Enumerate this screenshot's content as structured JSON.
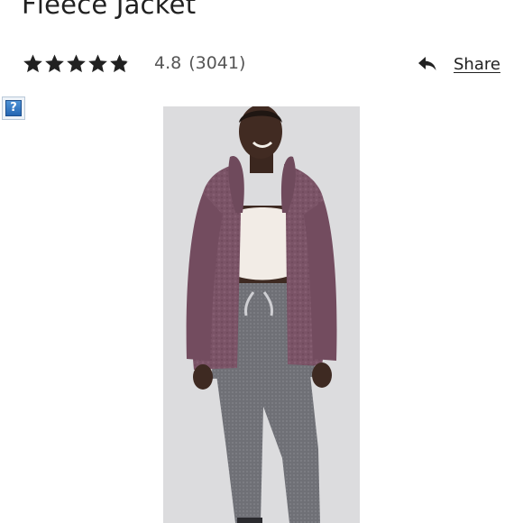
{
  "product": {
    "title": "Fleece Jacket",
    "rating": {
      "value": "4.8",
      "count": "(3041)",
      "stars": 4.8,
      "max_stars": 5
    },
    "share_label": "Share",
    "image_icon": "help-question-icon",
    "image_icon_glyph": "?",
    "image_alt": "Woman wearing mauve fleece jacket over white crop top and grey joggers"
  },
  "colors": {
    "text": "#212121",
    "muted": "#555555",
    "jacket": "#7a5366",
    "photo_bg": "#dcdcde"
  }
}
